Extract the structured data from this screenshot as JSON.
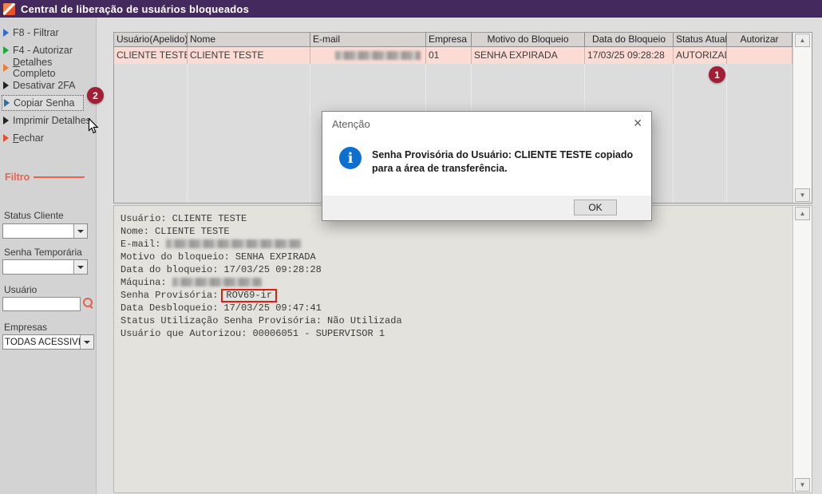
{
  "window": {
    "title": "Central de liberação de usuários bloqueados"
  },
  "colors": {
    "titlebar": "#44295f",
    "app_icon_orange": "#e8502a",
    "annotation_badge": "#a21e35",
    "highlight_box_red": "#e11c12",
    "filtro_accent": "#f0604a",
    "row_selected_pink": "#fbdbd3",
    "info_icon_blue": "#0d6fd0"
  },
  "sidebar": {
    "menu": [
      {
        "label": "F8 - Filtrar",
        "arrow_css": "border-left-color:#3a6bc9"
      },
      {
        "label": "F4 - Autorizar",
        "arrow_css": "border-left-color:#18a93c"
      },
      {
        "label_head": "D",
        "label_tail": "etalhes Completo",
        "arrow_css": "border-left-color:#ee7d31"
      },
      {
        "label": "Desativar 2FA",
        "arrow_css": "border-left-color:#222222"
      },
      {
        "label": "Copiar Senha",
        "arrow_css": "border-left-color:#2f6f9f"
      },
      {
        "label": "Imprimir Detalhes",
        "arrow_css": "border-left-color:#222222"
      },
      {
        "label_head": "F",
        "label_tail": "echar",
        "arrow_css": "border-left-color:#e8502a"
      }
    ],
    "filter": {
      "heading": "Filtro",
      "status_cliente_label": "Status Cliente",
      "status_cliente_value": "",
      "senha_temporaria_label": "Senha Temporária",
      "senha_temporaria_value": "",
      "usuario_label": "Usuário",
      "usuario_value": "",
      "empresas_label": "Empresas",
      "empresas_value": "TODAS ACESSÍVEIS"
    }
  },
  "table": {
    "columns": [
      "Usuário(Apelido)",
      "Nome",
      "E-mail",
      "Empresa",
      "Motivo do Bloqueio",
      "Data do Bloqueio",
      "Status Atual",
      "Autorizar"
    ],
    "row": {
      "usuario": "CLIENTE TESTE",
      "nome": "CLIENTE TESTE",
      "email_redacted": true,
      "empresa": "01",
      "motivo": "SENHA EXPIRADA",
      "data_bloqueio": "17/03/25 09:28:28",
      "status": "AUTORIZADO",
      "autorizar": ""
    }
  },
  "details": {
    "lines": [
      {
        "label": "Usuário:",
        "value": "CLIENTE TESTE"
      },
      {
        "label": "Nome:",
        "value": "CLIENTE TESTE"
      },
      {
        "label": "E-mail:",
        "value": "",
        "redacted": true
      },
      {
        "label": "Motivo do bloqueio:",
        "value": "SENHA EXPIRADA"
      },
      {
        "label": "Data do bloqueio:",
        "value": "17/03/25 09:28:28"
      },
      {
        "label": "Máquina:",
        "value": "",
        "redacted": true
      },
      {
        "label": "Senha Provisória:",
        "value": "ROV69-ir",
        "highlighted": true
      },
      {
        "label": "Data Desbloqueio:",
        "value": "17/03/25 09:47:41"
      },
      {
        "label": "Status Utilização Senha Provisória:",
        "value": "Não Utilizada"
      },
      {
        "label": "Usuário que Autorizou:",
        "value": "00006051 - SUPERVISOR 1"
      }
    ]
  },
  "dialog": {
    "title": "Atenção",
    "close_glyph": "✕",
    "info_glyph": "i",
    "message": "Senha Provisória do Usuário: CLIENTE TESTE copiado para a área de transferência.",
    "ok_label": "OK"
  },
  "annotations": {
    "badge_status": "1",
    "badge_copy": "2"
  },
  "scrollbar": {
    "up_glyph": "▲",
    "down_glyph": "▼"
  }
}
